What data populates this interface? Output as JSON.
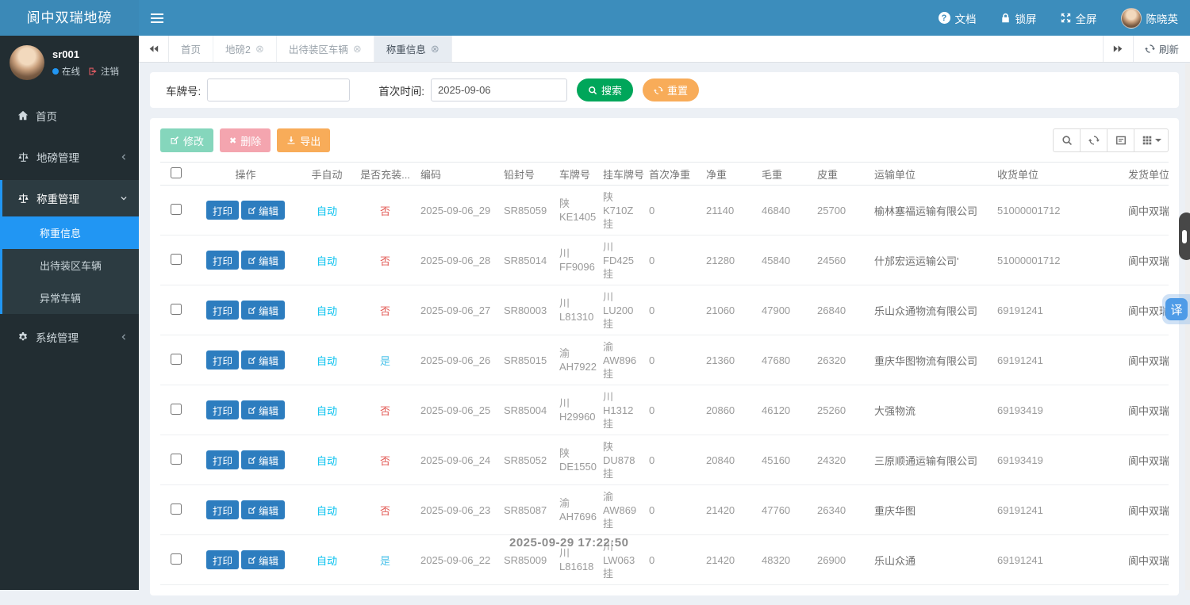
{
  "app": {
    "title": "阆中双瑞地磅",
    "user_name": "陈晓英",
    "nav": {
      "docs": "文档",
      "lock": "锁屏",
      "fullscreen": "全屏"
    }
  },
  "sidebar": {
    "username": "sr001",
    "status": "在线",
    "logout": "注销",
    "items": [
      {
        "label": "首页"
      },
      {
        "label": "地磅管理"
      },
      {
        "label": "称重管理",
        "children": [
          "称重信息",
          "出待装区车辆",
          "异常车辆"
        ],
        "active_child": "称重信息"
      },
      {
        "label": "系统管理"
      }
    ]
  },
  "tabs": {
    "items": [
      {
        "label": "首页",
        "closable": false,
        "active": false
      },
      {
        "label": "地磅2",
        "closable": true,
        "active": false
      },
      {
        "label": "出待装区车辆",
        "closable": true,
        "active": false
      },
      {
        "label": "称重信息",
        "closable": true,
        "active": true
      }
    ],
    "refresh": "刷新"
  },
  "search": {
    "plate_label": "车牌号:",
    "plate_value": "",
    "time_label": "首次时间:",
    "time_value": "2025-09-06",
    "search_label": "搜索",
    "reset_label": "重置"
  },
  "toolbar": {
    "modify": "修改",
    "delete": "删除",
    "export": "导出"
  },
  "table": {
    "print_label": "打印",
    "edit_label": "编辑",
    "headers": [
      "操作",
      "手自动",
      "是否充装...",
      "编码",
      "铅封号",
      "车牌号",
      "挂车牌号",
      "首次净重",
      "净重",
      "毛重",
      "皮重",
      "运输单位",
      "收货单位",
      "发货单位"
    ],
    "rows": [
      {
        "auto": "自动",
        "filled": "否",
        "code": "2025-09-06_29",
        "seal": "SR85059",
        "plate": [
          "陕",
          "KE1405"
        ],
        "trailer": [
          "陕",
          "K710Z",
          "挂"
        ],
        "first_net": "0",
        "net": "21140",
        "gross": "46840",
        "tare": "25700",
        "transport": "榆林塞福运输有限公司",
        "receiver": "51000001712",
        "sender": "阆中双瑞"
      },
      {
        "auto": "自动",
        "filled": "否",
        "code": "2025-09-06_28",
        "seal": "SR85014",
        "plate": [
          "川",
          "FF9096"
        ],
        "trailer": [
          "川",
          "FD425",
          "挂"
        ],
        "first_net": "0",
        "net": "21280",
        "gross": "45840",
        "tare": "24560",
        "transport": "什邡宏运运输公司'",
        "receiver": "51000001712",
        "sender": "阆中双瑞"
      },
      {
        "auto": "自动",
        "filled": "否",
        "code": "2025-09-06_27",
        "seal": "SR80003",
        "plate": [
          "川",
          "L81310"
        ],
        "trailer": [
          "川",
          "LU200",
          "挂"
        ],
        "first_net": "0",
        "net": "21060",
        "gross": "47900",
        "tare": "26840",
        "transport": "乐山众通物流有限公司",
        "receiver": "69191241",
        "sender": "阆中双瑞"
      },
      {
        "auto": "自动",
        "filled": "是",
        "code": "2025-09-06_26",
        "seal": "SR85015",
        "plate": [
          "渝",
          "AH7922"
        ],
        "trailer": [
          "渝",
          "AW896",
          "挂"
        ],
        "first_net": "0",
        "net": "21360",
        "gross": "47680",
        "tare": "26320",
        "transport": "重庆华图物流有限公司",
        "receiver": "69191241",
        "sender": "阆中双瑞"
      },
      {
        "auto": "自动",
        "filled": "否",
        "code": "2025-09-06_25",
        "seal": "SR85004",
        "plate": [
          "川",
          "H29960"
        ],
        "trailer": [
          "川",
          "H1312",
          "挂"
        ],
        "first_net": "0",
        "net": "20860",
        "gross": "46120",
        "tare": "25260",
        "transport": "大强物流",
        "receiver": "69193419",
        "sender": "阆中双瑞"
      },
      {
        "auto": "自动",
        "filled": "否",
        "code": "2025-09-06_24",
        "seal": "SR85052",
        "plate": [
          "陕",
          "DE1550"
        ],
        "trailer": [
          "陕",
          "DU878",
          "挂"
        ],
        "first_net": "0",
        "net": "20840",
        "gross": "45160",
        "tare": "24320",
        "transport": "三原顺通运输有限公司",
        "receiver": "69193419",
        "sender": "阆中双瑞"
      },
      {
        "auto": "自动",
        "filled": "否",
        "code": "2025-09-06_23",
        "seal": "SR85087",
        "plate": [
          "渝",
          "AH7696"
        ],
        "trailer": [
          "渝",
          "AW869",
          "挂"
        ],
        "first_net": "0",
        "net": "21420",
        "gross": "47760",
        "tare": "26340",
        "transport": "重庆华图",
        "receiver": "69191241",
        "sender": "阆中双瑞"
      },
      {
        "auto": "自动",
        "filled": "是",
        "code": "2025-09-06_22",
        "seal": "SR85009",
        "plate": [
          "川",
          "L81618"
        ],
        "trailer": [
          "川",
          "LW063",
          "挂"
        ],
        "first_net": "0",
        "net": "21420",
        "gross": "48320",
        "tare": "26900",
        "transport": "乐山众通",
        "receiver": "69191241",
        "sender": "阆中双瑞"
      }
    ]
  },
  "watermark": "2025-09-29 17:22:50",
  "floaters": {
    "translate": "译"
  },
  "colors": {
    "navbar": "#3c8dbc",
    "sidebar": "#222d32",
    "active_menu": "#2196f3",
    "search_btn": "#00a65a",
    "reset_btn": "#f8ac59",
    "export_btn": "#f8ac59",
    "row_btn": "#2d7dbf",
    "auto_text": "#00c0ef",
    "no_text": "#e25752",
    "yes_text": "#4fc3ea"
  }
}
